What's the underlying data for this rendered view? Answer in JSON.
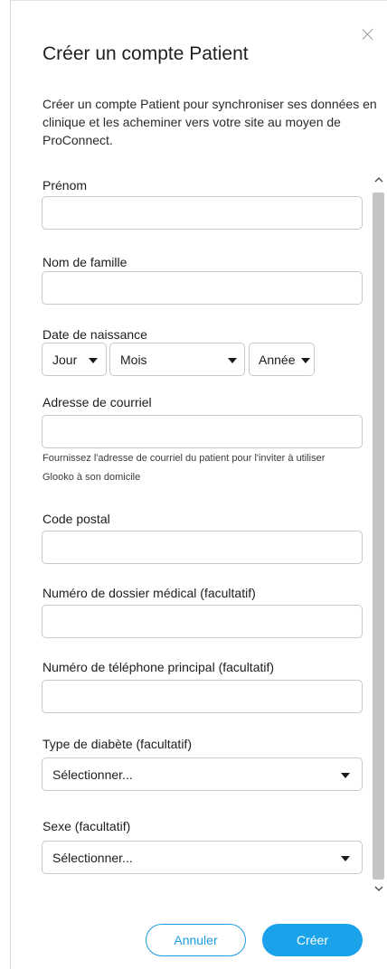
{
  "dialog": {
    "title": "Créer un compte Patient",
    "intro": "Créer un compte Patient pour synchroniser ses données en clinique et les acheminer vers votre site au moyen de ProConnect."
  },
  "form": {
    "first_name": {
      "label": "Prénom",
      "value": ""
    },
    "last_name": {
      "label": "Nom de famille",
      "value": ""
    },
    "birth_date": {
      "label": "Date de naissance",
      "day": "Jour",
      "month": "Mois",
      "year": "Année"
    },
    "email": {
      "label": "Adresse de courriel",
      "value": "",
      "help": "Fournissez l'adresse de courriel du patient pour l'inviter à utiliser Glooko à son domicile"
    },
    "postal_code": {
      "label": "Code postal",
      "value": ""
    },
    "medical_record": {
      "label": "Numéro de dossier médical (facultatif)",
      "value": ""
    },
    "phone": {
      "label": "Numéro de téléphone principal (facultatif)",
      "value": ""
    },
    "diabetes_type": {
      "label": "Type de diabète (facultatif)",
      "selected": "Sélectionner..."
    },
    "sex": {
      "label": "Sexe (facultatif)",
      "selected": "Sélectionner..."
    }
  },
  "actions": {
    "cancel_label": "Annuler",
    "create_label": "Créer"
  },
  "icons": {
    "close": "close-icon",
    "caret": "caret-down-icon",
    "scroll_up": "scroll-up-icon",
    "scroll_down": "scroll-down-icon"
  },
  "colors": {
    "accent": "#1aa2ea",
    "border": "#c9c9c9",
    "scroll_thumb": "#c4c4c4"
  }
}
